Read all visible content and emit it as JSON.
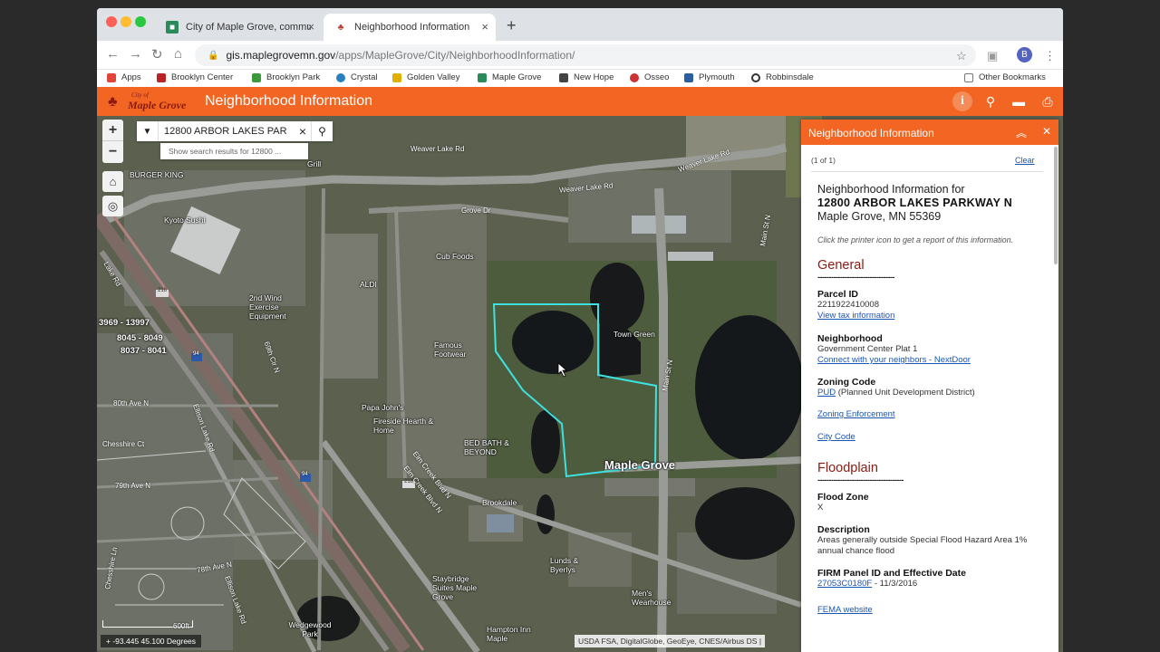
{
  "browser": {
    "tabs": [
      {
        "title": "City of Maple Grove, communi",
        "icon": "maple-grove-favicon"
      },
      {
        "title": "Neighborhood Information",
        "icon": "maple-leaf-favicon"
      }
    ],
    "url_host": "gis.maplegrovemn.gov",
    "url_path": "/apps/MapleGrove/City/NeighborhoodInformation/",
    "profile_initial": "B",
    "bookmarks": [
      {
        "label": "Apps",
        "color": "#e0453a"
      },
      {
        "label": "Brooklyn Center",
        "color": "#b22"
      },
      {
        "label": "Brooklyn Park",
        "color": "#3c9a3c"
      },
      {
        "label": "Crystal",
        "color": "#2a7fc1"
      },
      {
        "label": "Golden Valley",
        "color": "#e0b000"
      },
      {
        "label": "Maple Grove",
        "color": "#2a8a5a"
      },
      {
        "label": "New Hope",
        "color": "#444"
      },
      {
        "label": "Osseo",
        "color": "#c33"
      },
      {
        "label": "Plymouth",
        "color": "#2a5fa0"
      },
      {
        "label": "Robbinsdale",
        "color": "#333"
      }
    ],
    "other_bookmarks": "Other Bookmarks"
  },
  "app": {
    "logo_city": "City of",
    "logo_name": "Maple Grove",
    "title": "Neighborhood Information",
    "accent": "#f26522"
  },
  "search": {
    "value": "12800 ARBOR LAKES PAR",
    "hint": "Show search results for 12800 ..."
  },
  "map": {
    "labels": [
      "Weaver Lake Rd",
      "Weaver Lake Rd",
      "Weaver Lake Rd",
      "Grove Dr",
      "Main St N",
      "Main St N",
      "Cub Foods",
      "ALDI",
      "Town Green",
      "2nd Wind Exercise Equipment",
      "Famous Footwear",
      "Papa John's",
      "Fireside Hearth & Home",
      "BED BATH & BEYOND",
      "Kyoto Sushi",
      "80th Ave N",
      "79th Ave N",
      "78th Ave N",
      "Elm Creek Blvd N",
      "Elm Creek Blvd N",
      "Ellison Lake Rd",
      "Ellison Lake Rd",
      "Chesshire Ct",
      "Chesshire Ln",
      "Brookdale",
      "Lunds & Byerlys",
      "Staybridge Suites Maple Grove",
      "Hampton Inn Maple",
      "Men's Wearhouse",
      "Wedgewood Park",
      "69th Cir N",
      "Lake Rd",
      "BURGER KING",
      "Grill"
    ],
    "parcel_labels": [
      "3969 - 13997",
      "8045 - 8049",
      "8037 - 8041"
    ],
    "city_label": "Maple Grove",
    "route_shields": [
      "94",
      "94",
      "218",
      "218"
    ],
    "scale_label": "600ft",
    "coordinates": "-93.445 45.100 Degrees",
    "attribution": "USDA FSA, DigitalGlobe, GeoEye, CNES/Airbus DS |"
  },
  "panel": {
    "title": "Neighborhood Information",
    "pager": "(1 of 1)",
    "clear": "Clear",
    "heading": "Neighborhood Information for",
    "address_line1": "12800 ARBOR LAKES PARKWAY N",
    "address_line2": "Maple Grove, MN 55369",
    "note": "Click the printer icon to get a report of this information.",
    "general": {
      "title": "General",
      "divider": "----------------------------------",
      "parcel_id_label": "Parcel ID",
      "parcel_id": "2211922410008",
      "tax_link": "View tax information",
      "neighborhood_label": "Neighborhood",
      "neighborhood": "Government Center Plat 1",
      "nextdoor_link": "Connect with your neighbors - NextDoor",
      "zoning_label": "Zoning Code",
      "zoning_code": "PUD",
      "zoning_desc": "(Planned Unit Development District)",
      "zoning_enforcement": "Zoning Enforcement",
      "city_code": "City Code"
    },
    "floodplain": {
      "title": "Floodplain",
      "divider": "--------------------------------------",
      "flood_zone_label": "Flood Zone",
      "flood_zone": "X",
      "description_label": "Description",
      "description": "Areas generally outside Special Flood Hazard Area 1% annual chance flood",
      "firm_label": "FIRM Panel ID and Effective Date",
      "firm_id": "27053C0180F",
      "firm_date": "- 11/3/2016",
      "fema_link": "FEMA website"
    }
  }
}
